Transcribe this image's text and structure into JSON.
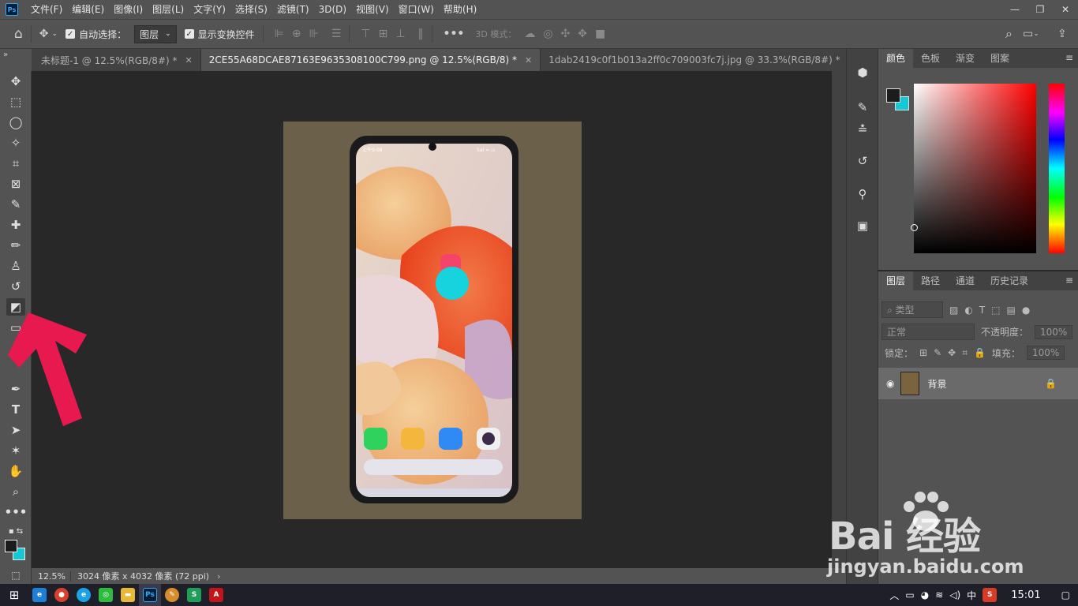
{
  "app": {
    "logo": "Ps"
  },
  "menu": [
    "文件(F)",
    "编辑(E)",
    "图像(I)",
    "图层(L)",
    "文字(Y)",
    "选择(S)",
    "滤镜(T)",
    "3D(D)",
    "视图(V)",
    "窗口(W)",
    "帮助(H)"
  ],
  "options": {
    "auto_select_label": "自动选择：",
    "auto_select_value": "图层",
    "show_transform_label": "显示变换控件",
    "mode_3d_label": "3D 模式："
  },
  "tabs": [
    {
      "label": "未标题-1 @ 12.5%(RGB/8#) *"
    },
    {
      "label": "2CE55A68DCAE87163E9635308100C799.png @ 12.5%(RGB/8) *"
    },
    {
      "label": "1dab2419c0f1b013a2ff0c709003fc7j.jpg @ 33.3%(RGB/8#) *"
    }
  ],
  "status": {
    "zoom": "12.5%",
    "doc_info": "3024 像素 x 4032 像素 (72 ppi)"
  },
  "color_panel": {
    "tabs": [
      "颜色",
      "色板",
      "渐变",
      "图案"
    ],
    "foreground": "#1c1c1c",
    "background": "#15c8d6"
  },
  "layers_panel": {
    "tabs": [
      "图层",
      "路径",
      "通道",
      "历史记录"
    ],
    "filter_placeholder": "类型",
    "blend_mode": "正常",
    "opacity_label": "不透明度：",
    "opacity_value": "100%",
    "lock_label": "锁定：",
    "fill_label": "填充：",
    "fill_value": "100%",
    "layers": [
      {
        "name": "背景",
        "locked": true
      }
    ]
  },
  "phone": {
    "status_time": "上午9:08",
    "status_icons": "5al ≈ ▭"
  },
  "taskbar": {
    "time": "15:01",
    "ime": "中"
  },
  "watermark": {
    "brand": "Bai 经验",
    "url": "jingyan.baidu.com"
  },
  "annotation": {
    "arrow_color": "#e8194f",
    "highlight_color": "#16d3dd"
  }
}
